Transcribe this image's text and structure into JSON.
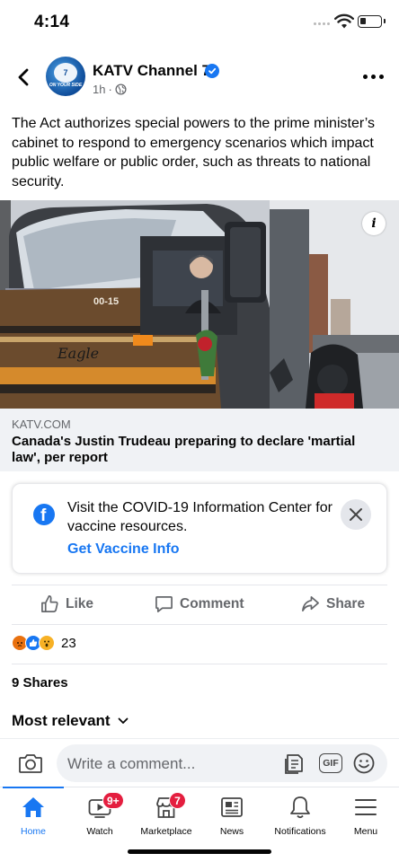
{
  "status_bar": {
    "time": "4:14"
  },
  "post": {
    "page_name": "KATV Channel 7",
    "timestamp": "1h",
    "meta_separator": "·",
    "text": "The Act authorizes special powers to the prime minister’s cabinet to respond to emergency scenarios which impact public welfare or public order, such as threats to national security.",
    "info_label": "i",
    "avatar_logo": "7",
    "avatar_tagline": "ON YOUR SIDE",
    "image_truck_number": "00-15",
    "image_truck_brand": "Eagle"
  },
  "link_preview": {
    "domain": "KATV.COM",
    "title": "Canada's Justin Trudeau preparing to declare 'martial law', per report"
  },
  "covid_card": {
    "text": "Visit the COVID-19 Information Center for vaccine resources.",
    "link": "Get Vaccine Info"
  },
  "actions": {
    "like": "Like",
    "comment": "Comment",
    "share": "Share"
  },
  "reactions": {
    "icons": [
      "angry-icon",
      "like-icon",
      "wow-icon"
    ],
    "count": "23"
  },
  "shares": "9 Shares",
  "sort": {
    "label": "Most relevant"
  },
  "comment_bar": {
    "placeholder": "Write a comment...",
    "gif_label": "GIF"
  },
  "tabs": [
    {
      "label": "Home",
      "icon": "home-icon",
      "active": true
    },
    {
      "label": "Watch",
      "icon": "watch-icon",
      "badge": "9+"
    },
    {
      "label": "Marketplace",
      "icon": "marketplace-icon",
      "badge": "7"
    },
    {
      "label": "News",
      "icon": "news-icon"
    },
    {
      "label": "Notifications",
      "icon": "bell-icon"
    },
    {
      "label": "Menu",
      "icon": "menu-icon"
    }
  ],
  "colors": {
    "accent": "#1877f2",
    "badge": "#e41e3f",
    "secondary_text": "#65676b"
  }
}
